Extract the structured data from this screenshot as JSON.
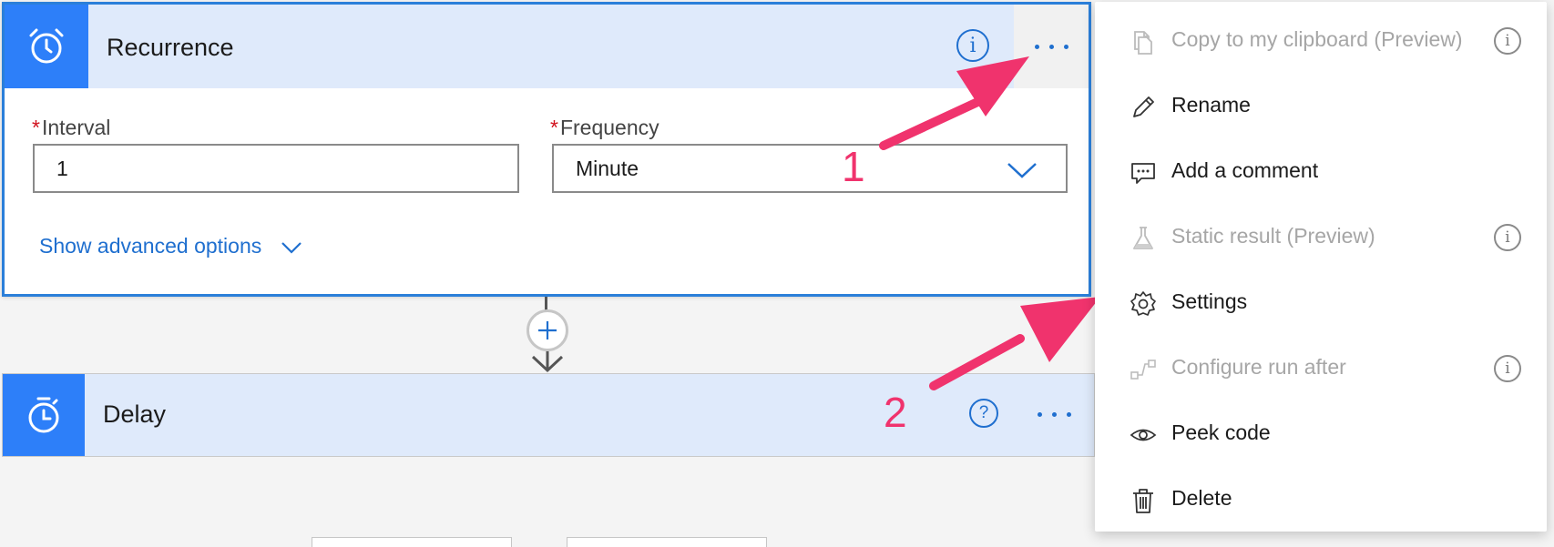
{
  "recurrence": {
    "title": "Recurrence",
    "info_glyph": "i",
    "interval": {
      "label": "Interval",
      "required_mark": "*",
      "value": "1"
    },
    "frequency": {
      "label": "Frequency",
      "required_mark": "*",
      "value": "Minute"
    },
    "advanced_label": "Show advanced options"
  },
  "delay": {
    "title": "Delay",
    "help_glyph": "?"
  },
  "menu": {
    "info_glyph": "i",
    "items": [
      {
        "label": "Copy to my clipboard (Preview)",
        "icon": "copy-icon",
        "enabled": false,
        "info": true
      },
      {
        "label": "Rename",
        "icon": "pencil-icon",
        "enabled": true,
        "info": false
      },
      {
        "label": "Add a comment",
        "icon": "comment-icon",
        "enabled": true,
        "info": false
      },
      {
        "label": "Static result (Preview)",
        "icon": "flask-icon",
        "enabled": false,
        "info": true
      },
      {
        "label": "Settings",
        "icon": "gear-icon",
        "enabled": true,
        "info": false
      },
      {
        "label": "Configure run after",
        "icon": "run-after-icon",
        "enabled": false,
        "info": true
      },
      {
        "label": "Peek code",
        "icon": "eye-icon",
        "enabled": true,
        "info": false
      },
      {
        "label": "Delete",
        "icon": "trash-icon",
        "enabled": true,
        "info": false
      }
    ]
  },
  "annotations": {
    "callout_1": "1",
    "callout_2": "2"
  },
  "colors": {
    "accent": "#2d7ff9",
    "link": "#1f6fcf",
    "header_bg": "#dfeafb",
    "annotation": "#f0336d",
    "required": "#d1111d",
    "disabled_text": "#a6a6a6"
  }
}
